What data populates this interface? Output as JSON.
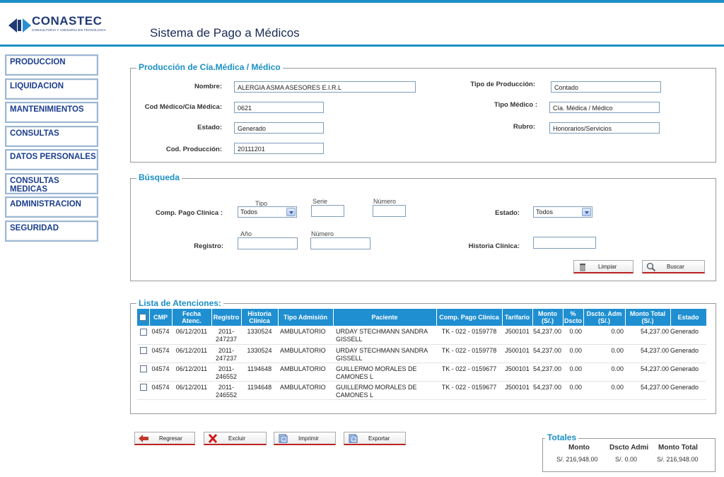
{
  "header": {
    "logo_text": "CONASTEC",
    "logo_sub": "CONSULTORIA Y ASESORIA EN TECNOLOGIA",
    "title": "Sistema de Pago a Médicos"
  },
  "menu": [
    "PRODUCCION",
    "LIQUIDACION",
    "MANTENIMIENTOS",
    "CONSULTAS",
    "DATOS PERSONALES",
    "CONSULTAS MEDICAS",
    "ADMINISTRACION",
    "SEGURIDAD"
  ],
  "produccion": {
    "legend": "Producción de Cía.Médica / Médico",
    "nombre_label": "Nombre:",
    "nombre": "ALERGIA ASMA ASESORES E.I.R.L",
    "cod_label": "Cod Médico/Cía Médica:",
    "cod": "0621",
    "estado_label": "Estado:",
    "estado": "Generado",
    "codprod_label": "Cod. Producción:",
    "codprod": "20111201",
    "tipo_prod_label": "Tipo de Producción:",
    "tipo_prod": "Contado",
    "tipo_medico_label": "Tipo Médico :",
    "tipo_medico": "Cía. Médica / Médico",
    "rubro_label": "Rubro:",
    "rubro": "Honorarios/Servicios"
  },
  "busqueda": {
    "legend": "Búsqueda",
    "comp_label": "Comp. Pago Clínica :",
    "tipo_cap": "Tipo",
    "tipo_value": "Todos",
    "serie_cap": "Serie",
    "numero_cap": "Número",
    "estado_label": "Estado:",
    "estado_value": "Todos",
    "registro_label": "Registro:",
    "anio_cap": "Año",
    "numero2_cap": "Número",
    "historia_label": "Historia Clínica:",
    "limpiar": "Limpiar",
    "buscar": "Buscar"
  },
  "lista": {
    "legend": "Lista de Atenciones:",
    "columns": [
      "CMP",
      "Fecha Atenc.",
      "Registro",
      "Historia Clínica",
      "Tipo Admisión",
      "Paciente",
      "Comp. Pago Clinica",
      "Tarifario",
      "Monto (S/.)",
      "% Dscto",
      "Dscto. Adm (S/.)",
      "Monto Total (S/.)",
      "Estado"
    ],
    "rows": [
      [
        "04574",
        "06/12/2011",
        "2011-247237",
        "1330524",
        "AMBULATORIO",
        "URDAY STECHMANN SANDRA GISSELL",
        "TK - 022 - 0159778",
        "J500101",
        "54,237.00",
        "0.00",
        "0.00",
        "54,237.00",
        "Generado"
      ],
      [
        "04574",
        "06/12/2011",
        "2011-247237",
        "1330524",
        "AMBULATORIO",
        "URDAY STECHMANN SANDRA GISSELL",
        "TK - 022 - 0159778",
        "J500101",
        "54,237.00",
        "0.00",
        "0.00",
        "54,237.00",
        "Generado"
      ],
      [
        "04574",
        "06/12/2011",
        "2011-246552",
        "1194648",
        "AMBULATORIO",
        "GUILLERMO MORALES DE CAMONES L",
        "TK - 022 - 0159677",
        "J500101",
        "54,237.00",
        "0.00",
        "0.00",
        "54,237.00",
        "Generado"
      ],
      [
        "04574",
        "06/12/2011",
        "2011-246552",
        "1194648",
        "AMBULATORIO",
        "GUILLERMO MORALES DE CAMONES L",
        "TK - 022 - 0159677",
        "J500101",
        "54,237.00",
        "0.00",
        "0.00",
        "54,237.00",
        "Generado"
      ]
    ]
  },
  "actions": {
    "regresar": "Regresar",
    "excluir": "Excluir",
    "imprimir": "Imprimir",
    "exportar": "Exportar"
  },
  "totales": {
    "legend": "Totales",
    "monto_label": "Monto",
    "dscto_label": "Dscto Admi",
    "total_label": "Monto Total",
    "monto": "S/. 216,948.00",
    "dscto": "S/. 0.00",
    "total": "S/. 216,948.00"
  },
  "colors": {
    "accent": "#1b8fc6",
    "header_blue": "#1f8fd1",
    "menu_text": "#1a3d8f"
  }
}
